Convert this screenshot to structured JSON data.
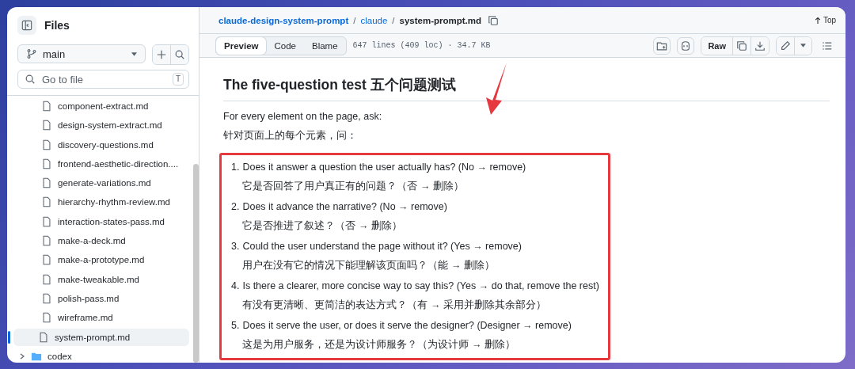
{
  "sidebar": {
    "title": "Files",
    "branch": "main",
    "search": {
      "placeholder": "Go to file",
      "shortcut": "T"
    },
    "tree": [
      {
        "children": [
          {
            "kind": "file",
            "name": "component-extract.md",
            "selected": false
          },
          {
            "kind": "file",
            "name": "design-system-extract.md",
            "selected": false
          },
          {
            "kind": "file",
            "name": "discovery-questions.md",
            "selected": false
          },
          {
            "kind": "file",
            "name": "frontend-aesthetic-direction....",
            "selected": false
          },
          {
            "kind": "file",
            "name": "generate-variations.md",
            "selected": false
          },
          {
            "kind": "file",
            "name": "hierarchy-rhythm-review.md",
            "selected": false
          },
          {
            "kind": "file",
            "name": "interaction-states-pass.md",
            "selected": false
          },
          {
            "kind": "file",
            "name": "make-a-deck.md",
            "selected": false
          },
          {
            "kind": "file",
            "name": "make-a-prototype.md",
            "selected": false
          },
          {
            "kind": "file",
            "name": "make-tweakable.md",
            "selected": false
          },
          {
            "kind": "file",
            "name": "polish-pass.md",
            "selected": false
          },
          {
            "kind": "file",
            "name": "wireframe.md",
            "selected": false
          },
          {
            "kind": "file",
            "name": "system-prompt.md",
            "selected": true
          }
        ]
      },
      {
        "kind": "folder",
        "name": "codex",
        "expanded": false,
        "selected": false
      }
    ]
  },
  "breadcrumb": {
    "links": [
      "claude-design-system-prompt",
      "claude"
    ],
    "separators": [
      "/",
      "/"
    ],
    "current": "system-prompt.md",
    "top": "Top"
  },
  "toolbar": {
    "tabs": [
      {
        "label": "Preview",
        "selected": true
      },
      {
        "label": "Code",
        "selected": false
      },
      {
        "label": "Blame",
        "selected": false
      }
    ],
    "info": "647 lines (409 loc) · 34.7 KB",
    "raw": "Raw"
  },
  "document": {
    "heading": "The five-question test  五个问题测试",
    "paragraphs": [
      "For every element on the page, ask:",
      "针对页面上的每个元素，问："
    ],
    "items": [
      {
        "number": "1.",
        "text": "Does it answer a question the user actually has? (No → remove)",
        "translation": "它是否回答了用户真正有的问题？（否 → 删除）"
      },
      {
        "number": "2.",
        "text": "Does it advance the narrative? (No → remove)",
        "translation": "它是否推进了叙述？（否 → 删除）"
      },
      {
        "number": "3.",
        "text": "Could the user understand the page without it? (Yes → remove)",
        "translation": "用户在没有它的情况下能理解该页面吗？（能 → 删除）"
      },
      {
        "number": "4.",
        "text": "Is there a clearer, more concise way to say this? (Yes → do that, remove the rest)",
        "translation": "有没有更清晰、更简洁的表达方式？（有 → 采用并删除其余部分）"
      },
      {
        "number": "5.",
        "text": "Does it serve the user, or does it serve the designer? (Designer → remove)",
        "translation": "这是为用户服务，还是为设计师服务？（为设计师 → 删除）"
      }
    ]
  }
}
